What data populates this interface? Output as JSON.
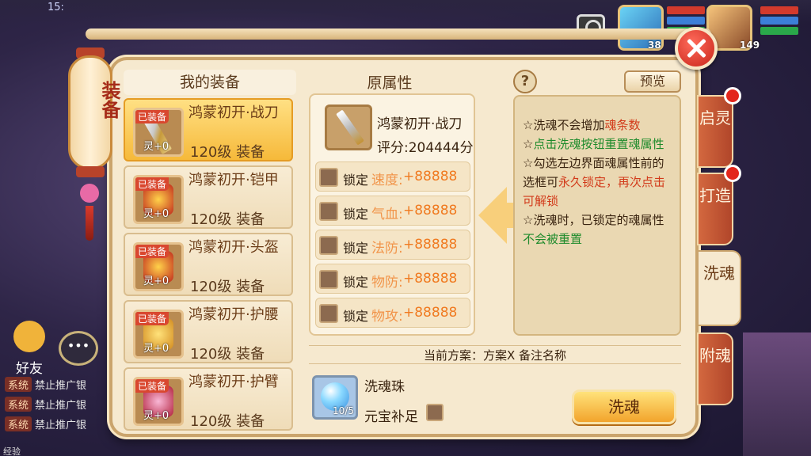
{
  "status": {
    "time": "15:"
  },
  "heroes": [
    {
      "level": "38"
    },
    {
      "level": "149"
    }
  ],
  "lantern": {
    "text": "装备"
  },
  "left_panel": {
    "friend_label": "好友",
    "system_messages": [
      {
        "tag": "系统",
        "text": "禁止推广银"
      },
      {
        "tag": "系统",
        "text": "禁止推广银"
      },
      {
        "tag": "系统",
        "text": "禁止推广银"
      }
    ],
    "exp_label": "经验"
  },
  "equipment": {
    "header": "我的装备",
    "items": [
      {
        "tag": "已装备",
        "name": "鸿蒙初开·战刀",
        "level": "120级 装备",
        "spirit": "灵+0",
        "selected": true,
        "icon": "sword-icon"
      },
      {
        "tag": "已装备",
        "name": "鸿蒙初开·铠甲",
        "level": "120级 装备",
        "spirit": "灵+0",
        "selected": false,
        "icon": "armor-icon"
      },
      {
        "tag": "已装备",
        "name": "鸿蒙初开·头盔",
        "level": "120级 装备",
        "spirit": "灵+0",
        "selected": false,
        "icon": "helmet-icon"
      },
      {
        "tag": "已装备",
        "name": "鸿蒙初开·护腰",
        "level": "120级 装备",
        "spirit": "灵+0",
        "selected": false,
        "icon": "belt-icon"
      },
      {
        "tag": "已装备",
        "name": "鸿蒙初开·护臂",
        "level": "120级 装备",
        "spirit": "灵+0",
        "selected": false,
        "icon": "bracer-icon"
      }
    ]
  },
  "original": {
    "title": "原属性",
    "weapon_name": "鸿蒙初开·战刀",
    "score": "评分:204444分",
    "lock_label": "锁定",
    "attributes": [
      {
        "name": "速度:",
        "value": "+88888"
      },
      {
        "name": "气血:",
        "value": "+88888"
      },
      {
        "name": "法防:",
        "value": "+88888"
      },
      {
        "name": "物防:",
        "value": "+88888"
      },
      {
        "name": "物攻:",
        "value": "+88888"
      }
    ]
  },
  "tips": {
    "help": "?",
    "preview_button": "预览",
    "lines": [
      {
        "prefix": "☆洗魂不会增加",
        "highlight": "魂条数",
        "suffix": ""
      },
      {
        "prefix": "☆",
        "highlight": "点击洗魂按钮重置魂属性",
        "suffix": ""
      },
      {
        "prefix": "☆勾选左边界面魂属性前的选框可",
        "highlight": "永久锁定，再次点击可解锁",
        "suffix": ""
      },
      {
        "prefix": "☆洗魂时，已锁定的魂属性",
        "highlight": "不会被重置",
        "suffix": ""
      }
    ]
  },
  "tabs": [
    {
      "label": "启灵",
      "dot": true,
      "active": false
    },
    {
      "label": "打造",
      "dot": true,
      "active": false
    },
    {
      "label": "洗魂",
      "dot": false,
      "active": true
    },
    {
      "label": "附魂",
      "dot": false,
      "active": false
    }
  ],
  "plan": {
    "text": "当前方案：方案X  备注名称"
  },
  "consumable": {
    "name": "洗魂珠",
    "count": "10/5",
    "ingot_label": "元宝补足"
  },
  "wash_button": "洗魂",
  "colors": {
    "accent_orange": "#f07a20",
    "green": "#1f8b2c",
    "red": "#d23a1a",
    "panel_bg": "#f6e9cf"
  }
}
